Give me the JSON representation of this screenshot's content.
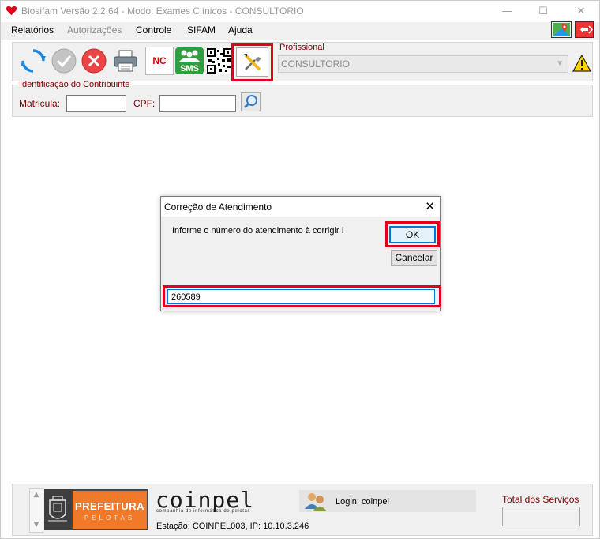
{
  "window": {
    "title": "Biosifam Versão 2.2.64 - Modo: Exames Clínicos - CONSULTORIO",
    "minimize_glyph": "—",
    "maximize_glyph": "☐",
    "close_glyph": "✕"
  },
  "menu": {
    "items": [
      {
        "label": "Relatórios",
        "enabled": true
      },
      {
        "label": "Autorizações",
        "enabled": false
      },
      {
        "label": "Controle",
        "enabled": true
      },
      {
        "label": "SIFAM",
        "enabled": true
      },
      {
        "label": "Ajuda",
        "enabled": true
      }
    ]
  },
  "toolbar": {
    "nc_label": "NC",
    "sms_label": "SMS",
    "icons": [
      "refresh-icon",
      "check-icon",
      "cancel-icon",
      "printer-icon",
      "nc-icon",
      "sms-icon",
      "qr-code-icon",
      "tools-icon"
    ]
  },
  "profissional": {
    "label": "Profissional",
    "selected": "CONSULTORIO"
  },
  "contribuinte": {
    "group_label": "Identificação do Contribuinte",
    "matricula_label": "Matricula:",
    "matricula_value": "",
    "cpf_label": "CPF:",
    "cpf_value": ""
  },
  "dialog": {
    "title": "Correção de Atendimento",
    "message": "Informe o número do atendimento à corrigir !",
    "ok_label": "OK",
    "cancel_label": "Cancelar",
    "input_value": "260589",
    "close_glyph": "✕"
  },
  "status": {
    "prefeitura_line1": "PREFEITURA",
    "prefeitura_line2": "PELOTAS",
    "coinpel_logo": "coinpel",
    "coinpel_sub": "companhia de informática de pelotas",
    "estacao": "Estação: COINPEL003, IP: 10.10.3.246",
    "login": "Login: coinpel",
    "total_label": "Total dos Serviços",
    "total_value": ""
  },
  "colors": {
    "highlight": "#e0001b",
    "label_red": "#7a0000",
    "accent_blue": "#0078d7",
    "prefeitura_orange": "#f07a2a"
  }
}
